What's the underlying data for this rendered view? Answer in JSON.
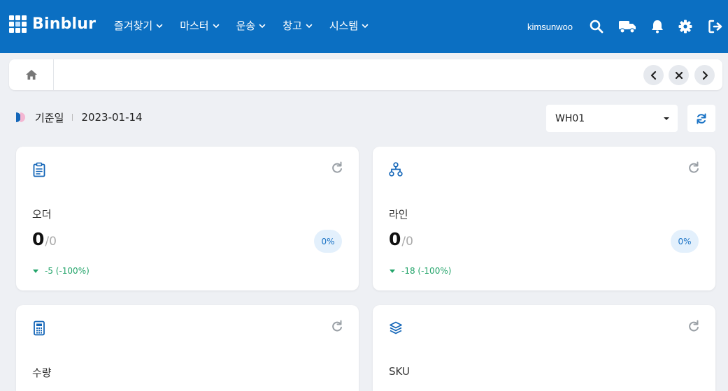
{
  "header": {
    "logo_text": "Binblur",
    "nav": [
      {
        "label": "즐겨찾기"
      },
      {
        "label": "마스터"
      },
      {
        "label": "운송"
      },
      {
        "label": "창고"
      },
      {
        "label": "시스템"
      }
    ],
    "username": "kimsunwoo",
    "icons": [
      "search-icon",
      "truck-icon",
      "bell-icon",
      "gear-icon",
      "logout-icon"
    ]
  },
  "tabbar": {
    "home_icon": "home-icon",
    "controls": [
      "chevron-left-icon",
      "close-icon",
      "chevron-right-icon"
    ]
  },
  "filters": {
    "date_label": "기준일",
    "date_value": "2023-01-14",
    "warehouse": "WH01"
  },
  "cards": [
    {
      "icon": "clipboard-icon",
      "label": "오더",
      "value": "0",
      "total": "/0",
      "percent": "0%",
      "delta": "-5 (-100%)"
    },
    {
      "icon": "hierarchy-icon",
      "label": "라인",
      "value": "0",
      "total": "/0",
      "percent": "0%",
      "delta": "-18 (-100%)"
    },
    {
      "icon": "calculator-icon",
      "label": "수량"
    },
    {
      "icon": "layers-icon",
      "label": "SKU"
    }
  ],
  "colors": {
    "header_bg": "#0b6fc2",
    "page_bg": "#eef0f4",
    "accent": "#1a73c5",
    "positive_delta": "#23a46a"
  }
}
